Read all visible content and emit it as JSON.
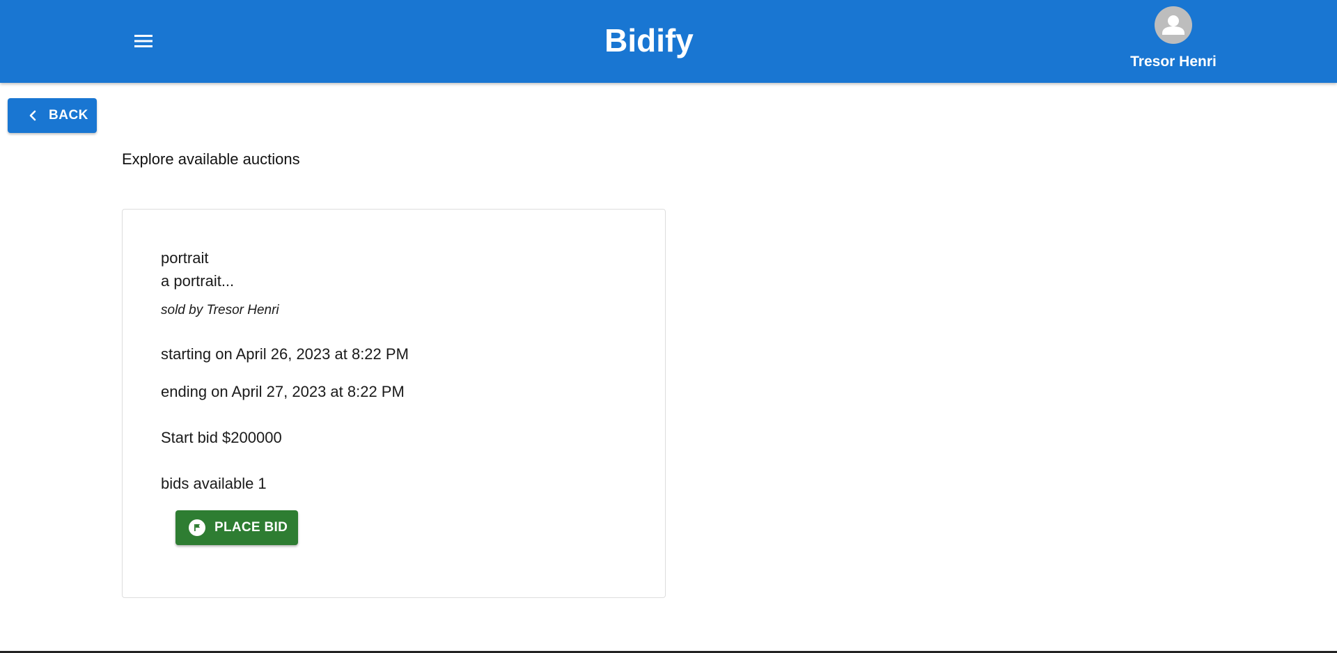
{
  "header": {
    "app_title": "Bidify",
    "user_name": "Tresor Henri",
    "menu_icon": "menu-icon",
    "avatar_icon": "person-icon",
    "color": "#1976d2"
  },
  "nav": {
    "back_label": "BACK"
  },
  "main": {
    "section_title": "Explore available auctions"
  },
  "auction": {
    "title": "portrait",
    "description": "a portrait...",
    "seller": "sold by Tresor Henri",
    "start": "starting on April 26, 2023 at 8:22 PM",
    "end": "ending on April 27, 2023 at 8:22 PM",
    "start_bid": "Start bid $200000",
    "bids_available": "bids available 1",
    "place_bid_label": "PLACE BID",
    "place_bid_color": "#2e7d32"
  }
}
